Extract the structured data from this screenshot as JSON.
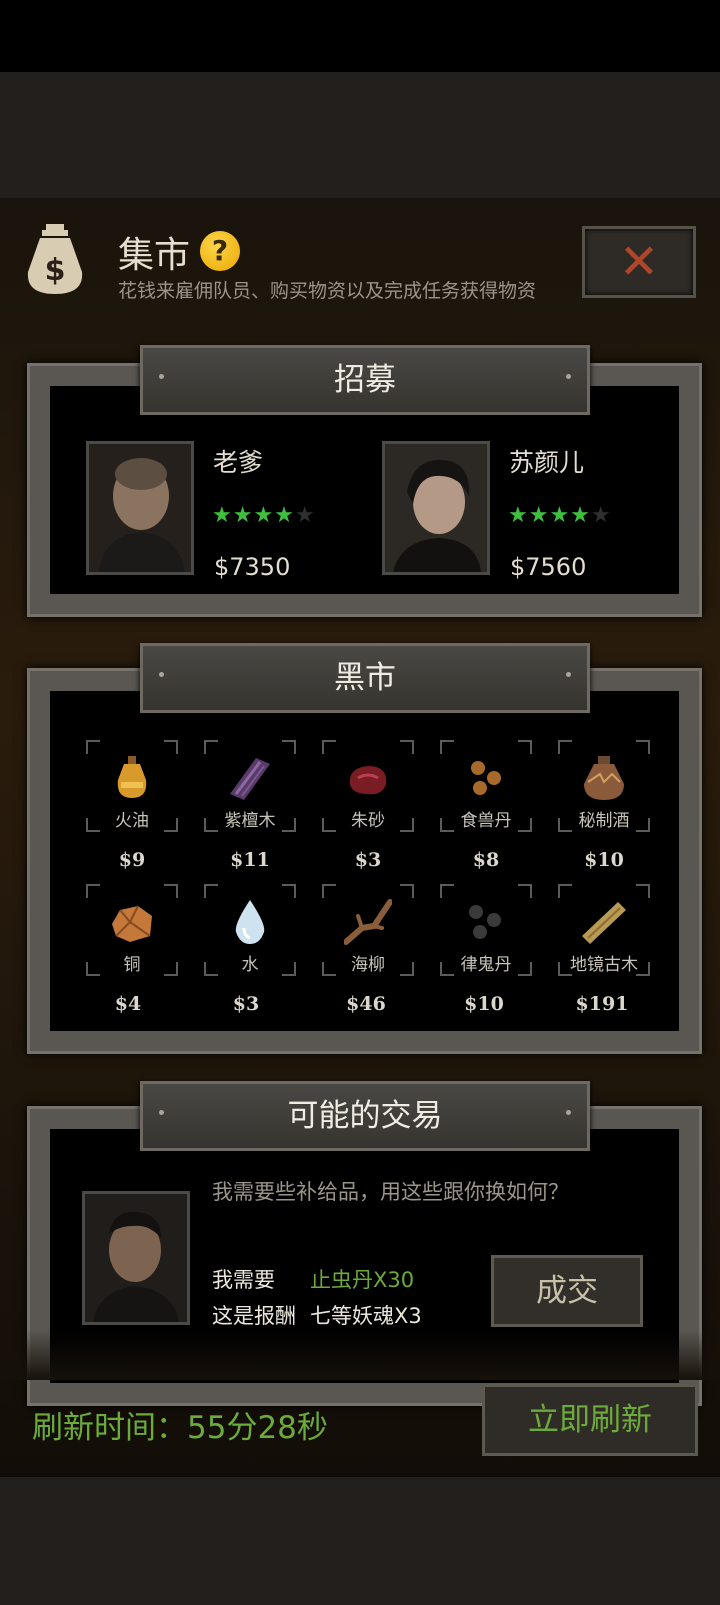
{
  "header": {
    "title": "集市",
    "help_glyph": "?",
    "subtitle": "花钱来雇佣队员、购买物资以及完成任务获得物资",
    "close_glyph": "✕"
  },
  "recruit": {
    "section_title": "招募",
    "mercenaries": [
      {
        "name": "老爹",
        "stars": 4,
        "max_stars": 5,
        "price": "$7350"
      },
      {
        "name": "苏颜儿",
        "stars": 4,
        "max_stars": 5,
        "price": "$7560"
      }
    ]
  },
  "black_market": {
    "section_title": "黑市",
    "items": [
      {
        "name": "火油",
        "price": "$9",
        "icon": "oil-bottle-icon"
      },
      {
        "name": "紫檀木",
        "price": "$11",
        "icon": "purple-wood-icon"
      },
      {
        "name": "朱砂",
        "price": "$3",
        "icon": "cinnabar-icon"
      },
      {
        "name": "食兽丹",
        "price": "$8",
        "icon": "pills-icon"
      },
      {
        "name": "秘制酒",
        "price": "$10",
        "icon": "wine-jar-icon"
      },
      {
        "name": "铜",
        "price": "$4",
        "icon": "copper-ore-icon"
      },
      {
        "name": "水",
        "price": "$3",
        "icon": "water-drop-icon"
      },
      {
        "name": "海柳",
        "price": "$46",
        "icon": "driftwood-icon"
      },
      {
        "name": "律鬼丹",
        "price": "$10",
        "icon": "black-pills-icon"
      },
      {
        "name": "地镜古木",
        "price": "$191",
        "icon": "ancient-wood-plank-icon"
      }
    ]
  },
  "trade": {
    "section_title": "可能的交易",
    "message": "我需要些补给品，用这些跟你换如何？",
    "need_label": "我需要",
    "need_value": "止虫丹X30",
    "reward_label": "这是报酬",
    "reward_value": "七等妖魂X3",
    "deal_button": "成交"
  },
  "footer": {
    "refresh_time": "刷新时间：55分28秒",
    "refresh_button": "立即刷新"
  }
}
